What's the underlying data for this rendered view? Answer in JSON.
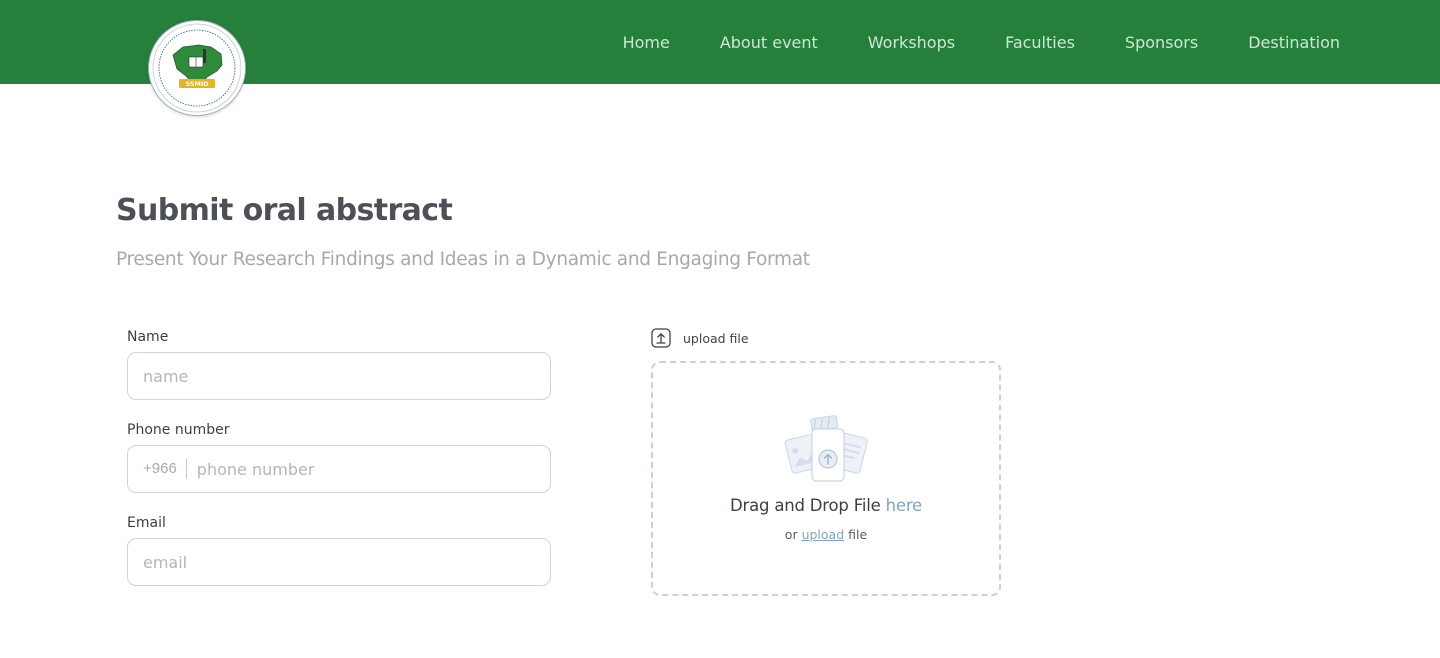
{
  "colors": {
    "header_bg": "#25803b",
    "nav_text": "#cfe6d4",
    "link_accent": "#7fa3c9",
    "dropzone_border": "#c3d3e6"
  },
  "header": {
    "logo_icon": "ssmid-logo",
    "nav": [
      {
        "label": "Home"
      },
      {
        "label": "About event"
      },
      {
        "label": "Workshops"
      },
      {
        "label": "Faculties"
      },
      {
        "label": "Sponsors"
      },
      {
        "label": "Destination"
      }
    ]
  },
  "page": {
    "title": "Submit oral abstract",
    "subtitle": "Present Your Research Findings and Ideas in a Dynamic and Engaging Format"
  },
  "form": {
    "name": {
      "label": "Name",
      "placeholder": "name",
      "value": ""
    },
    "phone": {
      "label": "Phone number",
      "prefix": "+966",
      "placeholder": "phone number",
      "value": ""
    },
    "email": {
      "label": "Email",
      "placeholder": "email",
      "value": ""
    }
  },
  "upload": {
    "icon": "upload-icon",
    "heading": "upload file",
    "drop_text": "Drag and Drop File",
    "drop_link": "here",
    "or_text": "or",
    "upload_link": "upload",
    "file_text": "file"
  }
}
